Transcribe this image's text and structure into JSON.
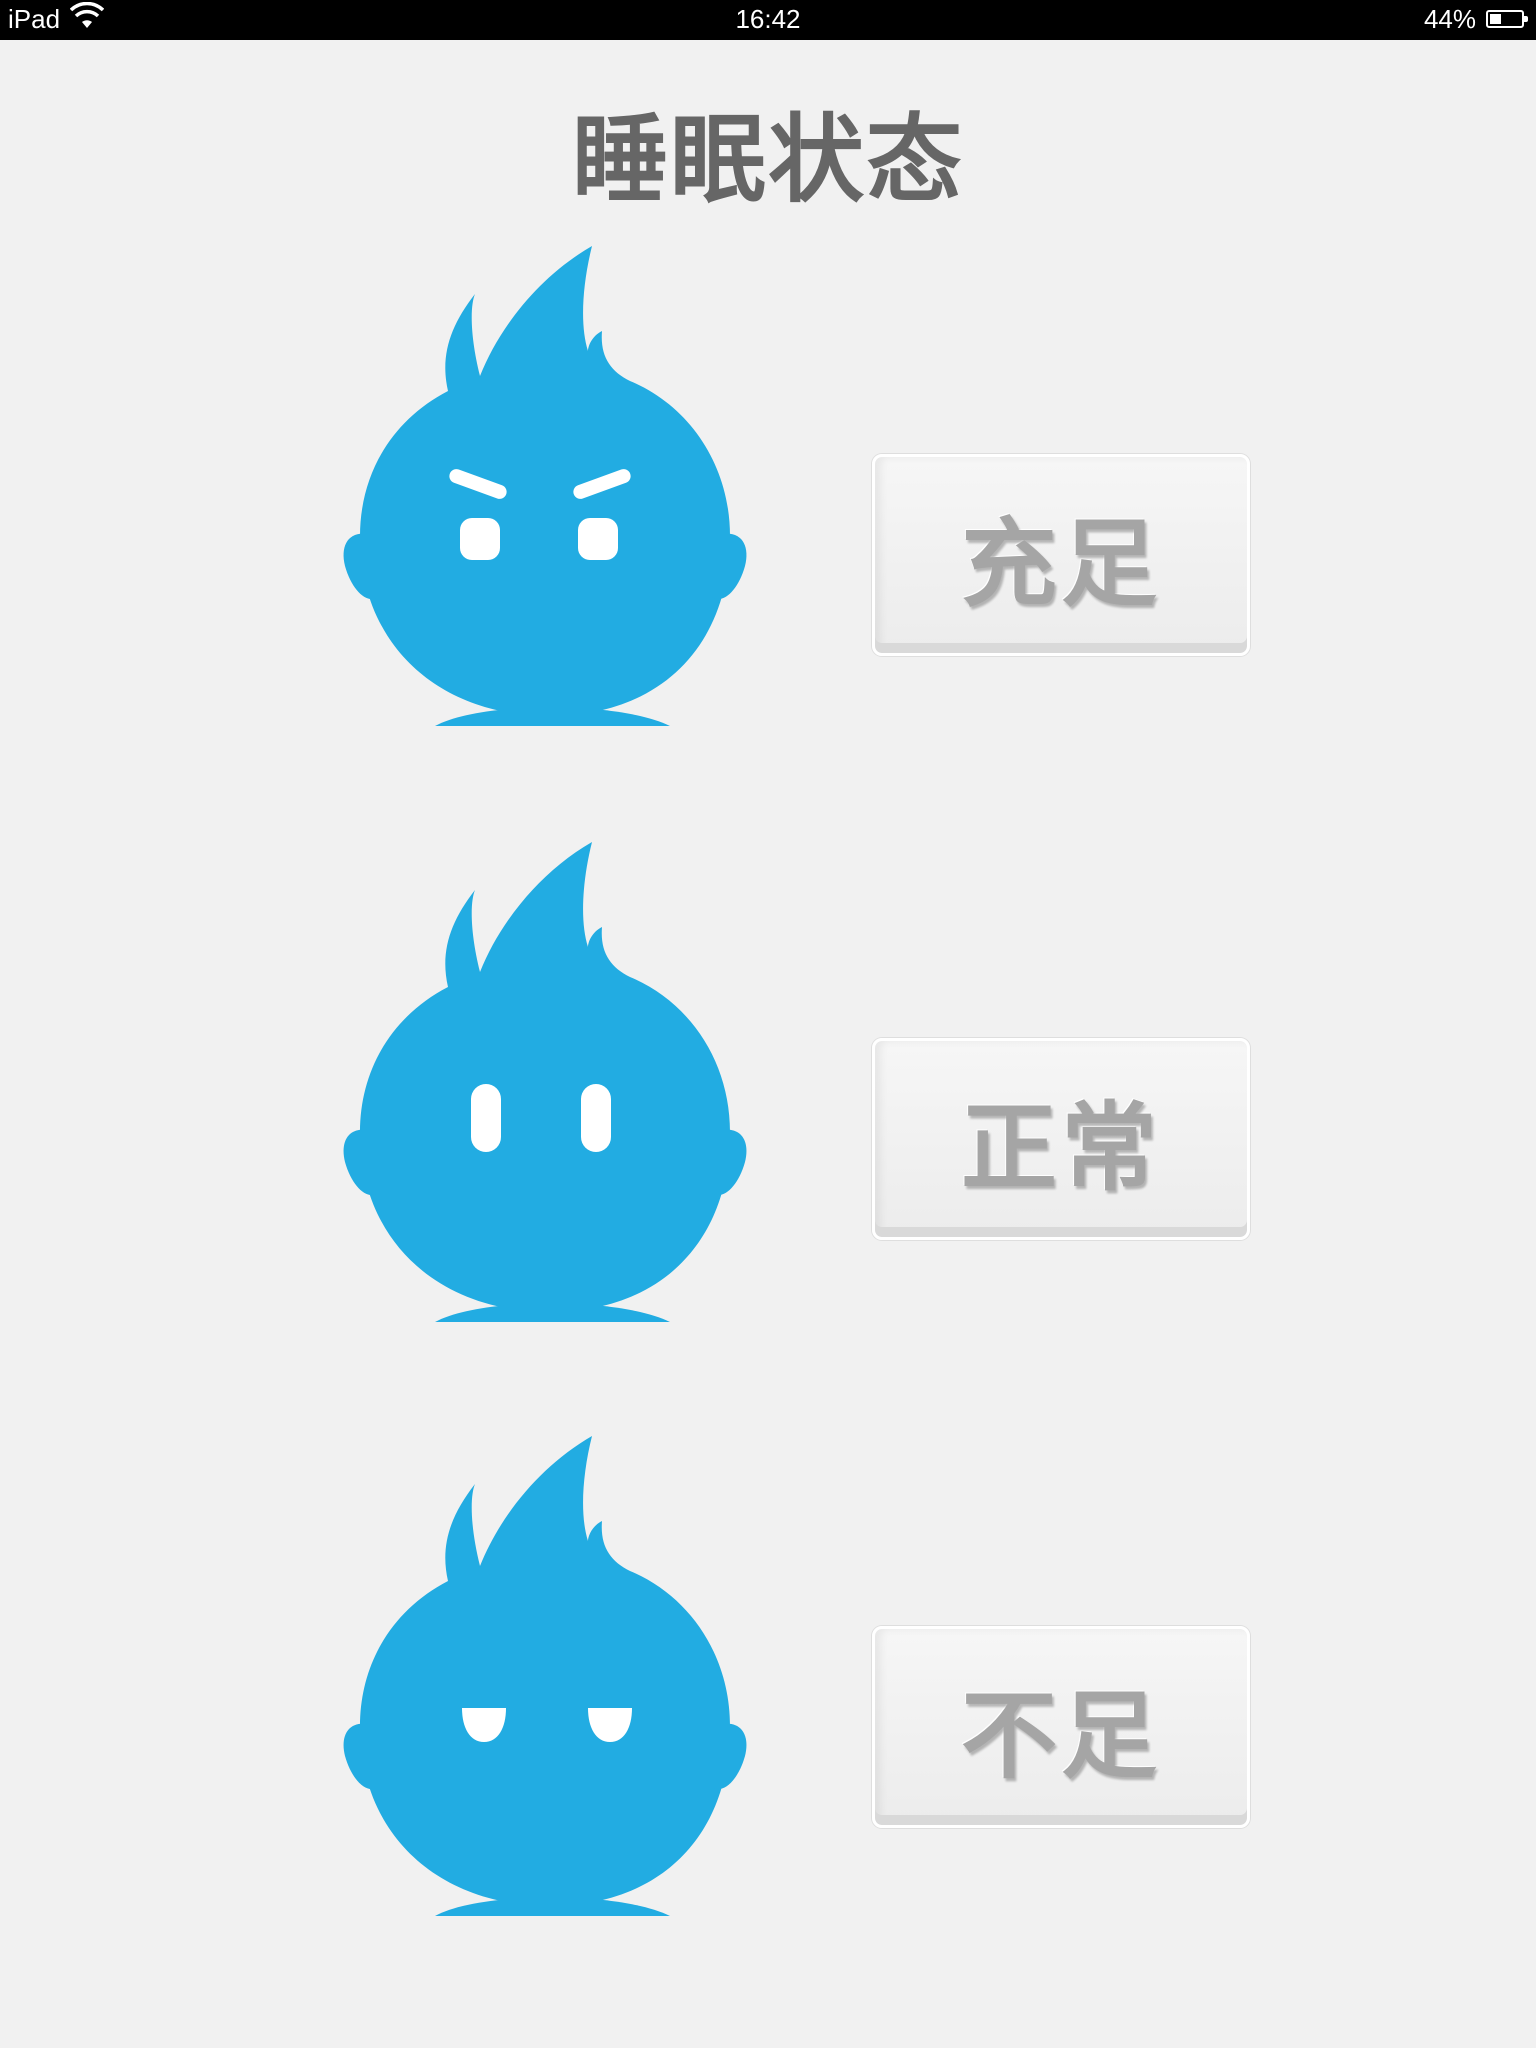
{
  "status_bar": {
    "carrier": "iPad",
    "time": "16:42",
    "battery_percent_label": "44%",
    "battery_level": 0.44,
    "wifi_icon": "wifi-icon",
    "battery_icon": "battery-icon"
  },
  "page": {
    "title": "睡眠状态"
  },
  "options": [
    {
      "label": "充足",
      "mascot_expression": "determined"
    },
    {
      "label": "正常",
      "mascot_expression": "neutral"
    },
    {
      "label": "不足",
      "mascot_expression": "sleepy"
    }
  ],
  "colors": {
    "background": "#f1f1f1",
    "mascot_blue": "#22ace2",
    "title_gray": "#666666",
    "button_text_gray": "#a5a5a5"
  }
}
